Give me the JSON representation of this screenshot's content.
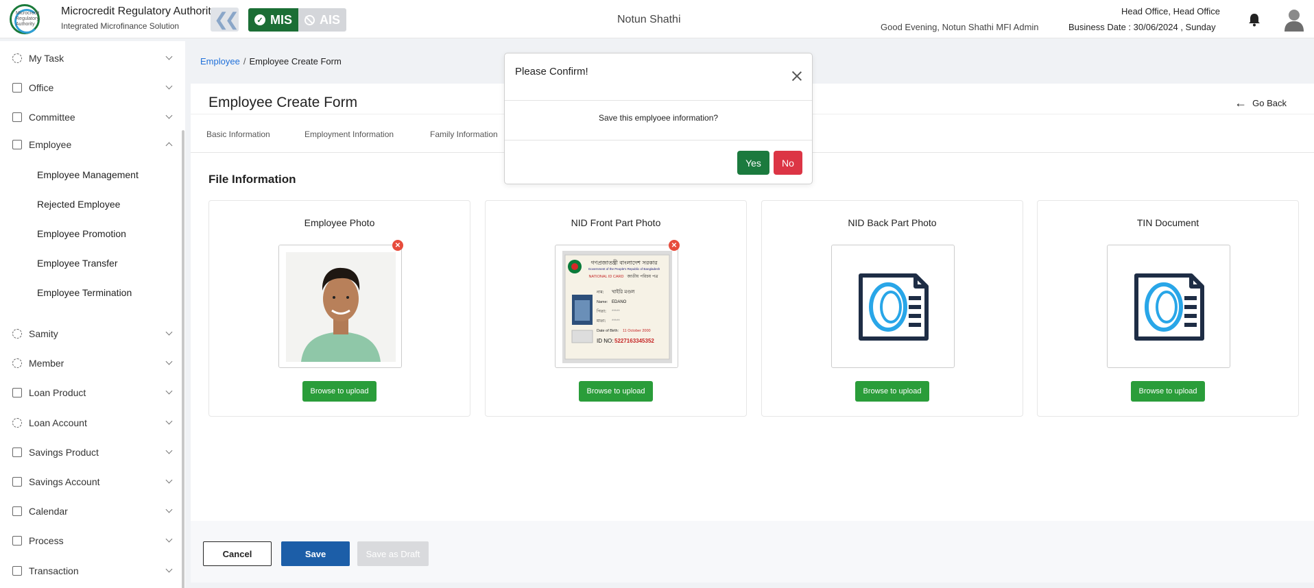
{
  "header": {
    "logo_text": "Microcredit Regulatory Authority",
    "org_title": "Microcredit Regulatory Authority",
    "org_subtitle": "Integrated Microfinance Solution",
    "mis_label": "MIS",
    "ais_label": "AIS",
    "center_title": "Notun Shathi",
    "greeting": "Good Evening, Notun Shathi MFI Admin",
    "office": "Head Office, Head Office",
    "business_date": "Business Date : 30/06/2024 , Sunday"
  },
  "sidebar": {
    "items": [
      {
        "label": "My Task"
      },
      {
        "label": "Office"
      },
      {
        "label": "Committee"
      },
      {
        "label": "Employee"
      },
      {
        "label": "Samity"
      },
      {
        "label": "Member"
      },
      {
        "label": "Loan Product"
      },
      {
        "label": "Loan Account"
      },
      {
        "label": "Savings Product"
      },
      {
        "label": "Savings Account"
      },
      {
        "label": "Calendar"
      },
      {
        "label": "Process"
      },
      {
        "label": "Transaction"
      }
    ],
    "employee_sub": [
      {
        "label": "Employee Management"
      },
      {
        "label": "Rejected Employee"
      },
      {
        "label": "Employee Promotion"
      },
      {
        "label": "Employee Transfer"
      },
      {
        "label": "Employee Termination"
      }
    ]
  },
  "breadcrumb": {
    "link": "Employee",
    "separator": "/",
    "current": "Employee Create Form"
  },
  "form": {
    "title": "Employee Create Form",
    "go_back": "Go Back",
    "tabs": [
      "Basic Information",
      "Employment Information",
      "Family Information"
    ],
    "section_title": "File Information",
    "files": [
      {
        "title": "Employee Photo",
        "button": "Browse to upload"
      },
      {
        "title": "NID Front Part Photo",
        "button": "Browse to upload"
      },
      {
        "title": "NID Back Part Photo",
        "button": "Browse to upload"
      },
      {
        "title": "TIN Document",
        "button": "Browse to upload"
      }
    ],
    "nid_card": {
      "gov_bn": "গণপ্রজাতন্ত্রী বাংলাদেশ সরকার",
      "gov_en": "Government of the People's Republic of Bangladesh",
      "card_en": "NATIONAL ID CARD",
      "card_bn": "জাতীয় পরিচয় পত্র",
      "name_bn_label": "নাম:",
      "name_bn_value": "খাইরি মণ্ডল",
      "name_en_label": "Name:",
      "name_en_value": "EDANO",
      "father_label": "পিতা:",
      "father_value": "*****",
      "mother_label": "মাতা:",
      "mother_value": "*****",
      "dob_label": "Date of Birth:",
      "dob_value": "11 October 2000",
      "id_label": "ID NO:",
      "id_value": "5227163345352"
    },
    "cancel": "Cancel",
    "save": "Save",
    "save_draft": "Save as Draft"
  },
  "modal": {
    "title": "Please Confirm!",
    "message": "Save this emplyoee information?",
    "yes": "Yes",
    "no": "No"
  }
}
